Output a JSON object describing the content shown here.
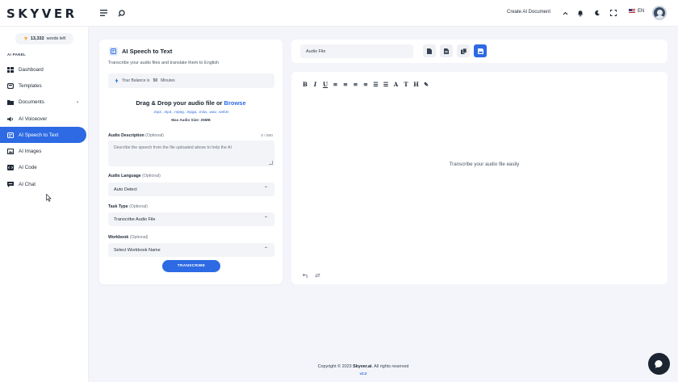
{
  "brand": {
    "logo": "SKYVER"
  },
  "topbar": {
    "create_doc": "Create AI Document",
    "lang": "EN"
  },
  "sidebar": {
    "words_count": "13,332",
    "words_label": "words left",
    "panel_label": "AI PANEL",
    "items": [
      {
        "label": "Dashboard",
        "icon": "grid-icon"
      },
      {
        "label": "Templates",
        "icon": "template-icon"
      },
      {
        "label": "Documents",
        "icon": "folder-icon"
      },
      {
        "label": "AI Voiceover",
        "icon": "speaker-icon"
      },
      {
        "label": "AI Speech to Text",
        "icon": "speech-icon",
        "active": true
      },
      {
        "label": "AI Images",
        "icon": "image-icon"
      },
      {
        "label": "AI Code",
        "icon": "code-icon"
      },
      {
        "label": "AI Chat",
        "icon": "chat-icon"
      }
    ]
  },
  "left_card": {
    "title": "AI Speech to Text",
    "subtitle": "Transcribe your audio files and translate them to English",
    "balance_prefix": "Your Balance is",
    "balance_value": "50",
    "balance_unit": "Minutes",
    "drop_title": "Drag & Drop your audio file or",
    "drop_browse": "Browse",
    "formats": ".mp3, .mp4, .mpeg, .mpga, .m4a, .wav, .webm",
    "max_size": "Max Audio Size: 25MB",
    "description_label": "Audio Description",
    "optional": "(Optional)",
    "description_counter": "0 / 500",
    "description_placeholder": "Describe the speech from the file uploaded above to help the AI",
    "language_label": "Audio Language",
    "language_value": "Auto Detect",
    "task_label": "Task Type",
    "task_value": "Transcribe Audio File",
    "workbook_label": "Workbook",
    "workbook_value": "Select Workbook Name",
    "transcribe_button": "TRANSCRIBE"
  },
  "right_top": {
    "file_input": "Audio File"
  },
  "editor": {
    "placeholder": "Transcribe your audio file easily",
    "tools": [
      "B",
      "I",
      "U",
      "≡",
      "≡",
      "≡",
      "≡",
      "☰",
      "☰",
      "A",
      "T",
      "H",
      "✎"
    ]
  },
  "footer": {
    "copyright": "Copyright © 2023",
    "brand": "Skyver.ai",
    "rights": ". All rights reserved",
    "version": "v2.2"
  },
  "colors": {
    "accent": "#2d6ae3",
    "dark": "#1b2430",
    "background": "#f4f5fa"
  }
}
